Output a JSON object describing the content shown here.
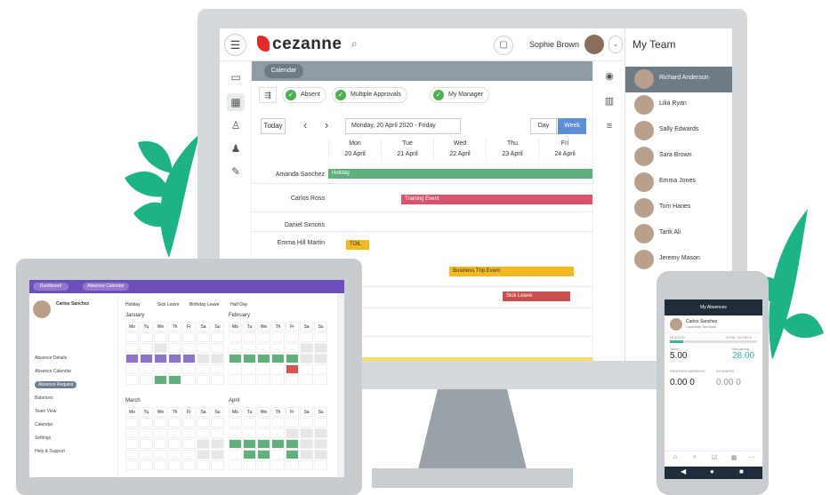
{
  "monitor": {
    "logo": "cezanne",
    "user_name": "Sophie Brown",
    "crumb": "Calendar",
    "filters": [
      "Absent",
      "Multiple Approvals",
      "My Manager"
    ],
    "calbar": {
      "today": "Today",
      "range": "Monday, 20 April 2020 - Friday",
      "day": "Day",
      "week": "Week"
    },
    "days": [
      {
        "name": "Mon",
        "date": "20 April"
      },
      {
        "name": "Tue",
        "date": "21 April"
      },
      {
        "name": "Wed",
        "date": "22 April"
      },
      {
        "name": "Thu",
        "date": "23 April"
      },
      {
        "name": "Fri",
        "date": "24 April"
      }
    ],
    "rows": [
      "Amanda Sanchez",
      "Carlos Ross",
      "Daniel Simons",
      "Emma Hill Martin"
    ],
    "bars": [
      {
        "label": "Holiday",
        "color": "#5fb07a"
      },
      {
        "label": "Training Event",
        "color": "#d9536b"
      },
      {
        "label": "TOIL",
        "color": "#f2b925"
      },
      {
        "label": "Business Trip Event",
        "color": "#f2b925"
      },
      {
        "label": "Sick Leave",
        "color": "#d9534f"
      }
    ],
    "team": {
      "title": "My Team",
      "members": [
        "Richard Anderson",
        "Lilia Ryan",
        "Sally Edwards",
        "Sara Brown",
        "Emma Jones",
        "Tom Hanes",
        "Tarik Ali",
        "Jeremy Mason"
      ]
    }
  },
  "tablet": {
    "pills": [
      "Dashboard",
      "Absence Calendar"
    ],
    "profile_name": "Carlos Sanchez",
    "menu": [
      "Absence Details",
      "Absence Calendar",
      "Absence Request",
      "Balances",
      "Team View",
      "Calendar",
      "Settings",
      "Help & Support"
    ],
    "legend": [
      "Holiday",
      "Sick Leave",
      "Birthday Leave",
      "Half Day"
    ],
    "months": [
      "January",
      "February",
      "March",
      "April"
    ],
    "weekdays": [
      "Mo",
      "Tu",
      "We",
      "Th",
      "Fr",
      "Sa",
      "Su"
    ]
  },
  "phone": {
    "title": "My Absences",
    "user": "Carlos Sanchez",
    "dept": "Customer Services",
    "holiday_label": "HOLIDAY",
    "total_label": "TOTAL 33 DAYS",
    "taken_label": "Taken",
    "taken_value": "5.00",
    "remaining_label": "Remaining",
    "remaining_value": "28.00",
    "weather_label": "WEATHER ABSENCE",
    "weather_value": "0.00 0",
    "sickness_label": "SICKNESS",
    "sickness_value": "0.00 0",
    "holiday_fraction": 0.15,
    "colors": {
      "accent": "#3bb59d",
      "purple": "#6c4fb8",
      "green": "#5fb07a",
      "red": "#d9534f",
      "yellow": "#f2b925"
    }
  }
}
